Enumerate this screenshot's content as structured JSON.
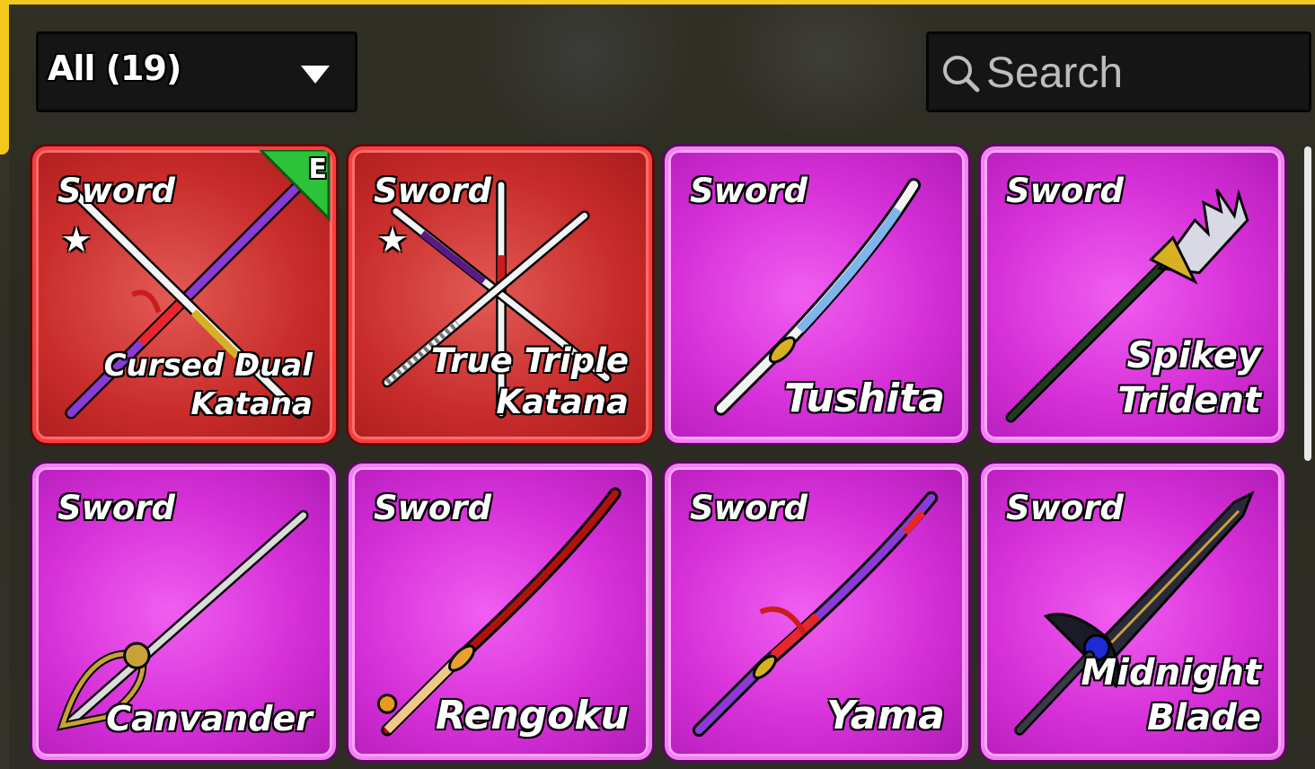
{
  "filter": {
    "label": "All (19)"
  },
  "search": {
    "placeholder": "Search"
  },
  "items": [
    {
      "type": "Sword",
      "name": "Cursed Dual\nKatana",
      "starred": true,
      "equipped_badge": "E",
      "rarity": "mythic"
    },
    {
      "type": "Sword",
      "name": "True Triple\nKatana",
      "starred": true,
      "rarity": "mythic"
    },
    {
      "type": "Sword",
      "name": "Tushita",
      "rarity": "legendary"
    },
    {
      "type": "Sword",
      "name": "Spikey\nTrident",
      "rarity": "legendary"
    },
    {
      "type": "Sword",
      "name": "Canvander",
      "rarity": "legendary"
    },
    {
      "type": "Sword",
      "name": "Rengoku",
      "rarity": "legendary"
    },
    {
      "type": "Sword",
      "name": "Yama",
      "rarity": "legendary"
    },
    {
      "type": "Sword",
      "name": "Midnight\nBlade",
      "rarity": "legendary"
    }
  ],
  "colors": {
    "mythic": "#c72b2a",
    "legendary": "#d630d8",
    "accent": "#f2c81d"
  },
  "icons": {
    "filter": "chevron-down-icon",
    "search": "search-icon",
    "star": "star-icon"
  }
}
